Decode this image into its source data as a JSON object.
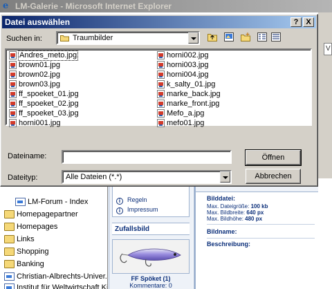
{
  "ie_window": {
    "title": "LM-Galerie - Microsoft Internet Explorer",
    "right_tab_text": "V"
  },
  "favorites": {
    "items": [
      {
        "label": "LM-Forum - Index",
        "icon": "page-icon"
      },
      {
        "label": "Homepagepartner",
        "icon": "folder-icon"
      },
      {
        "label": "Homepages",
        "icon": "folder-icon"
      },
      {
        "label": "Links",
        "icon": "folder-icon"
      },
      {
        "label": "Shopping",
        "icon": "folder-icon"
      },
      {
        "label": "Banking",
        "icon": "folder-icon"
      },
      {
        "label": "Christian-Albrechts-Univer...",
        "icon": "page-icon"
      },
      {
        "label": "Institut für Weltwirtschaft Kiel",
        "icon": "page-icon"
      }
    ]
  },
  "web_page": {
    "links": [
      "Regeln",
      "Impressum"
    ],
    "random_image_heading": "Zufallsbild",
    "image_title": "FF Spöket (1)",
    "image_comments": "Kommentare: 0",
    "upload_heading": "Bilddatei:",
    "limits": [
      {
        "label": "Max. Dateigröße:",
        "value": "100 kb"
      },
      {
        "label": "Max. Bildbreite:",
        "value": "640 px"
      },
      {
        "label": "Max. Bildhöhe:",
        "value": "480 px"
      }
    ],
    "name_label": "Bildname:",
    "description_label": "Beschreibung:"
  },
  "dialog": {
    "title": "Datei auswählen",
    "help_button": "?",
    "close_button": "X",
    "look_in_label": "Suchen in:",
    "look_in_value": "Traumbilder",
    "files_left": [
      "Andres_meto.jpg",
      "brown01.jpg",
      "brown02.jpg",
      "brown03.jpg",
      "ff_spoeket_01.jpg",
      "ff_spoeket_02.jpg",
      "ff_spoeket_03.jpg",
      "horni001.jpg"
    ],
    "files_right": [
      "horni002.jpg",
      "horni003.jpg",
      "horni004.jpg",
      "k_salty_01.jpg",
      "marke_back.jpg",
      "marke_front.jpg",
      "Mefo_a.jpg",
      "mefo01.jpg"
    ],
    "filename_label": "Dateiname:",
    "filename_value": "",
    "filetype_label": "Dateityp:",
    "filetype_value": "Alle Dateien (*.*)",
    "open_button": "Öffnen",
    "cancel_button": "Abbrechen"
  },
  "colors": {
    "title_active": "#0a246a",
    "title_gradient_end": "#a6caf0",
    "face": "#d4d0c8",
    "page_link": "#0b2f7a"
  }
}
